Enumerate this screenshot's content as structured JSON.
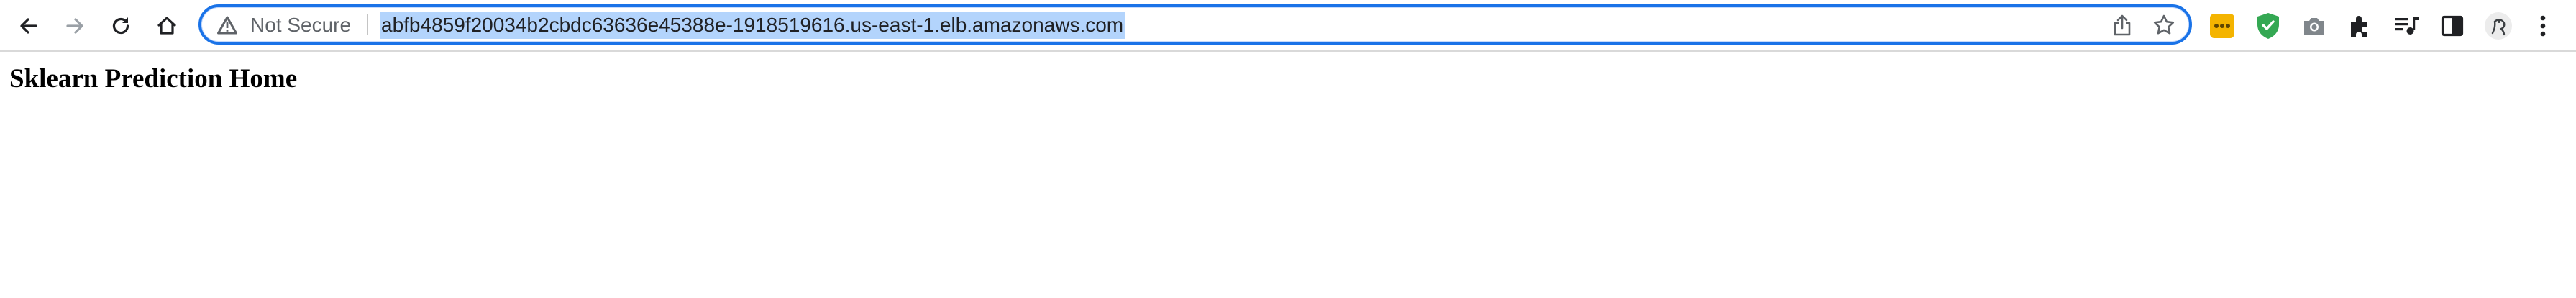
{
  "browser": {
    "nav": {
      "back": "back-icon",
      "forward": "forward-icon",
      "reload": "reload-icon",
      "home": "home-icon"
    },
    "omnibox": {
      "security_icon": "warning-triangle-icon",
      "security_label": "Not Secure",
      "url": "abfb4859f20034b2cbdc63636e45388e-1918519616.us-east-1.elb.amazonaws.com",
      "url_selected": true,
      "actions": [
        "share-icon",
        "bookmark-star-icon"
      ]
    },
    "extensions": [
      "password-manager-extension-icon",
      "shield-extension-icon",
      "camera-extension-icon",
      "puzzle-extensions-icon",
      "media-queue-icon",
      "side-panel-icon",
      "profile-avatar",
      "kebab-menu-icon"
    ],
    "colors": {
      "focus_ring": "#1a73e8",
      "selection": "#b3d4fc",
      "extension_yellow": "#f4b400",
      "extension_green": "#34a853"
    }
  },
  "page": {
    "heading": "Sklearn Prediction Home"
  }
}
